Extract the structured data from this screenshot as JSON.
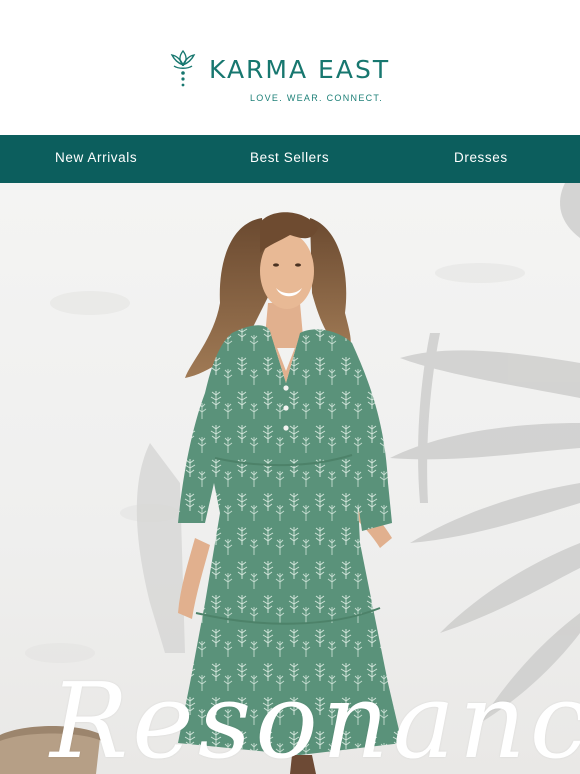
{
  "brand": {
    "name": "KARMA EAST",
    "tagline": "LOVE. WEAR. CONNECT.",
    "logo_icon": "lotus-icon",
    "color": "#17776f"
  },
  "nav": {
    "background": "#0c5e5d",
    "items": [
      {
        "label": "New Arrivals"
      },
      {
        "label": "Best Sellers"
      },
      {
        "label": "Dresses"
      }
    ]
  },
  "hero": {
    "title": "Resonance",
    "image": "woman-in-green-printed-dress"
  }
}
